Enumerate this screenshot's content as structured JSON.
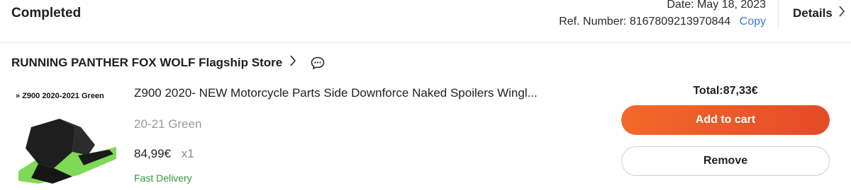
{
  "order": {
    "status": "Completed",
    "date": "Date: May 18, 2023",
    "ref_label": "Ref. Number:",
    "ref_number": "8167809213970844",
    "copy_label": "Copy",
    "details_label": "Details"
  },
  "store": {
    "name": "RUNNING PANTHER FOX WOLF Flagship Store"
  },
  "item": {
    "image_caption": "Z900  2020-2021 Green",
    "title": "Z900 2020- NEW Motorcycle Parts Side Downforce Naked Spoilers Wingl...",
    "variant": "20-21 Green",
    "price": "84,99€",
    "quantity": "x1",
    "delivery": "Fast Delivery"
  },
  "summary": {
    "total": "Total:87,33€",
    "add_to_cart": "Add to cart",
    "remove": "Remove"
  },
  "colors": {
    "accent": "#e85a28",
    "link": "#3a7bd5",
    "delivery": "#2f9a3f"
  },
  "icons": {
    "details": "chevron-right-icon",
    "store": "chevron-right-icon",
    "chat": "chat-bubble-icon"
  }
}
